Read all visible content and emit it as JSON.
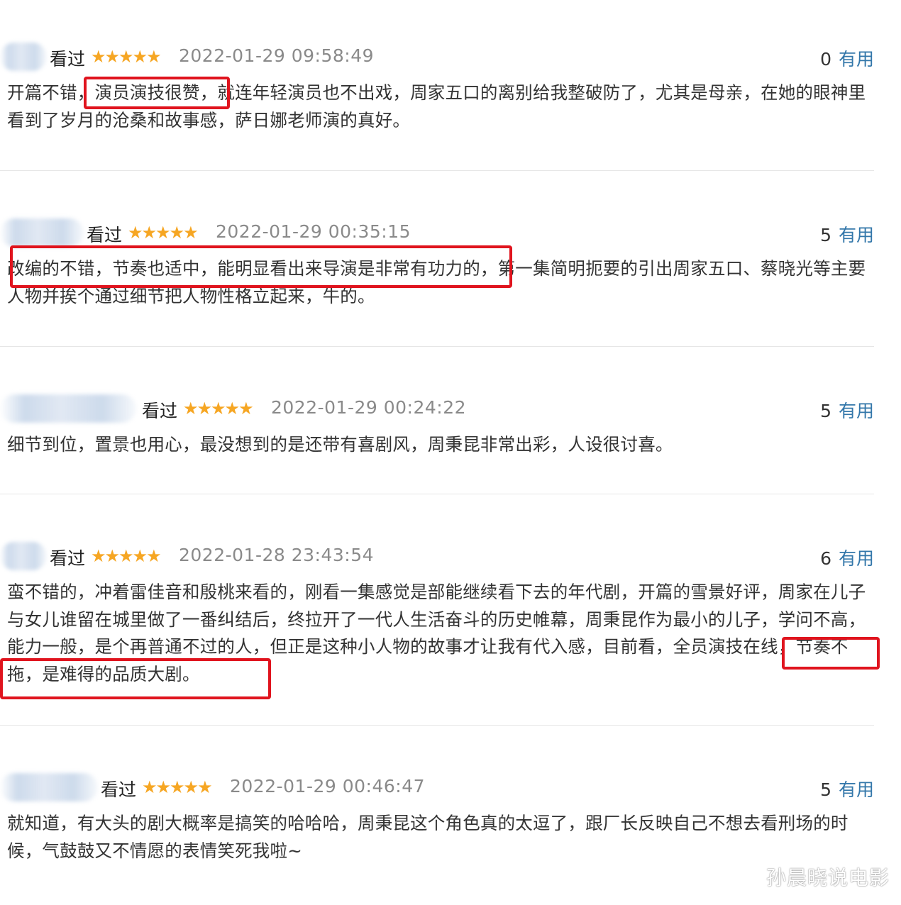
{
  "reviews": [
    {
      "status": "看过",
      "stars": "★★★★★",
      "date": "2022-01-29 09:58:49",
      "useful_count": "0",
      "useful_label": "有用",
      "text": "开篇不错，演员演技很赞，就连年轻演员也不出戏，周家五口的离别给我整破防了，尤其是母亲，在她的眼神里看到了岁月的沧桑和故事感，萨日娜老师演的真好。"
    },
    {
      "status": "看过",
      "stars": "★★★★★",
      "date": "2022-01-29 00:35:15",
      "useful_count": "5",
      "useful_label": "有用",
      "text": "改编的不错，节奏也适中，能明显看出来导演是非常有功力的，第一集简明扼要的引出周家五口、蔡晓光等主要人物并挨个通过细节把人物性格立起来，牛的。"
    },
    {
      "status": "看过",
      "stars": "★★★★★",
      "date": "2022-01-29 00:24:22",
      "useful_count": "5",
      "useful_label": "有用",
      "text": "细节到位，置景也用心，最没想到的是还带有喜剧风，周秉昆非常出彩，人设很讨喜。"
    },
    {
      "status": "看过",
      "stars": "★★★★★",
      "date": "2022-01-28 23:43:54",
      "useful_count": "6",
      "useful_label": "有用",
      "text": "蛮不错的，冲着雷佳音和殷桃来看的，刚看一集感觉是部能继续看下去的年代剧，开篇的雪景好评，周家在儿子与女儿谁留在城里做了一番纠结后，终拉开了一代人生活奋斗的历史帷幕，周秉昆作为最小的儿子，学问不高，能力一般，是个再普通不过的人，但正是这种小人物的故事才让我有代入感，目前看，全员演技在线，节奏不拖，是难得的品质大剧。"
    },
    {
      "status": "看过",
      "stars": "★★★★★",
      "date": "2022-01-29 00:46:47",
      "useful_count": "5",
      "useful_label": "有用",
      "text": "就知道，有大头的剧大概率是搞笑的哈哈哈，周秉昆这个角色真的太逗了，跟厂长反映自己不想去看刑场的时候，气鼓鼓又不情愿的表情笑死我啦~"
    }
  ],
  "watermark": "孙晨晓说电影",
  "colors": {
    "star": "#f6a623",
    "useful_link": "#3377aa",
    "highlight_box": "#e0141e",
    "date_gray": "#8a8a8a"
  }
}
